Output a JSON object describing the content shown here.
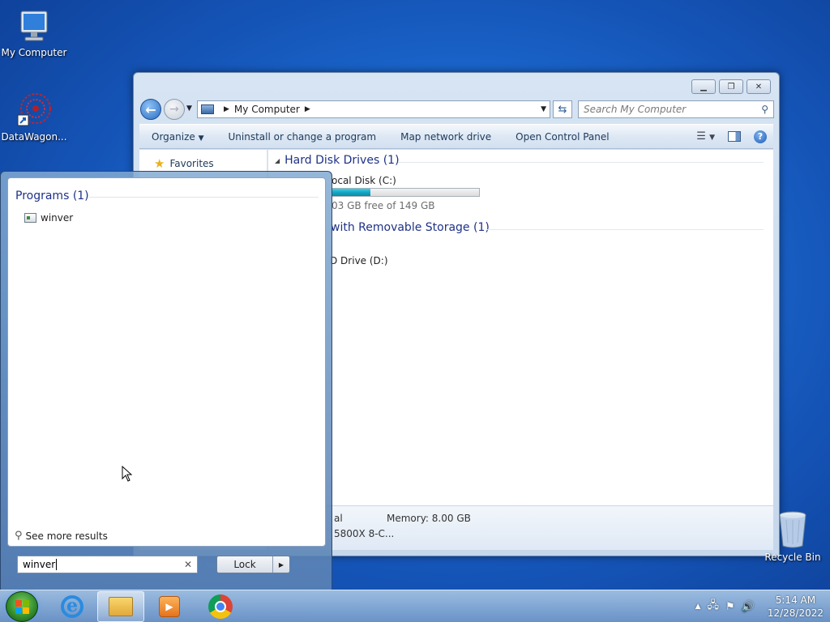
{
  "desktop": {
    "icons": [
      {
        "label": "My Computer"
      },
      {
        "label": "DataWagon..."
      }
    ],
    "recycle_bin": "Recycle Bin"
  },
  "explorer": {
    "address": "My Computer",
    "search_placeholder": "Search My Computer",
    "commands": [
      "Organize",
      "Uninstall or change a program",
      "Map network drive",
      "Open Control Panel"
    ],
    "nav": {
      "favorites": "Favorites"
    },
    "groups": {
      "hard_disk": "Hard Disk Drives (1)",
      "removable": "with Removable Storage (1)"
    },
    "drives": {
      "c_name": "ocal Disk (C:)",
      "c_free": "03 GB free of 149 GB",
      "c_used_fraction": 0.26,
      "d_name": "D Drive (D:)"
    },
    "details": {
      "left1": "al",
      "memory": "Memory: 8.00 GB",
      "left2": "5800X 8-C..."
    }
  },
  "start_menu": {
    "programs_header": "Programs (1)",
    "program_item": "winver",
    "see_more": "See more results",
    "search_value": "winver",
    "lock_label": "Lock"
  },
  "taskbar": {
    "time": "5:14 AM",
    "date": "12/28/2022"
  }
}
